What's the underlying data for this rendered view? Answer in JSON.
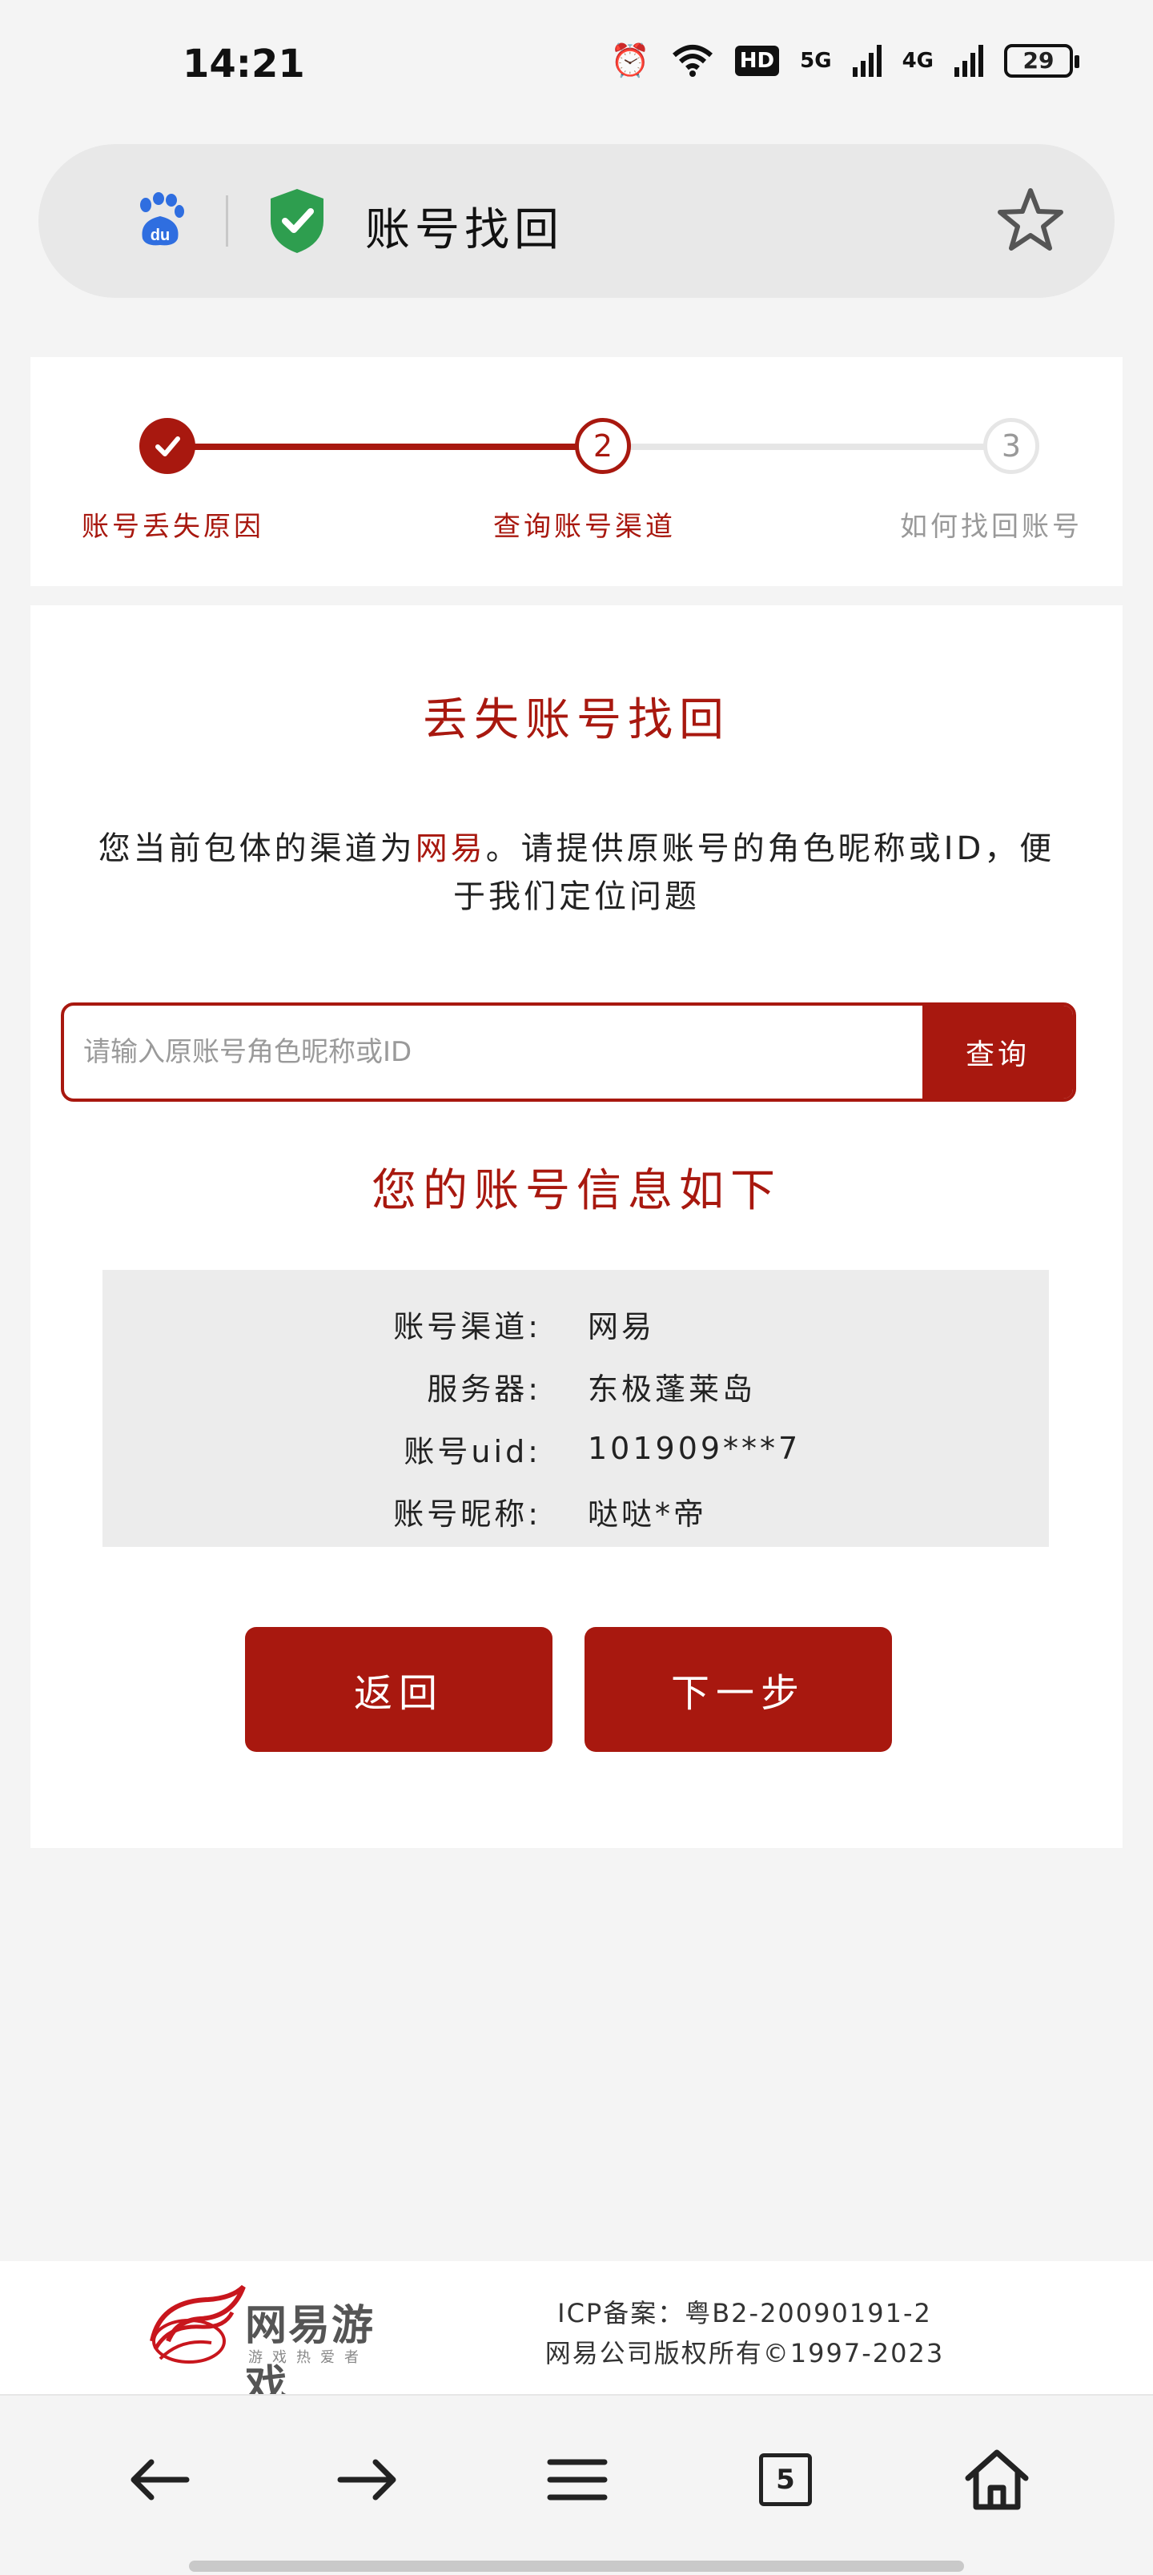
{
  "status_bar": {
    "time": "14:21",
    "hd_label": "HD",
    "network_1": "5G",
    "network_2": "4G",
    "battery": "29"
  },
  "address_bar": {
    "title": "账号找回",
    "baidu_logo_text": "du"
  },
  "stepper": {
    "steps": [
      {
        "number": "1",
        "label": "账号丢失原因",
        "state": "done"
      },
      {
        "number": "2",
        "label": "查询账号渠道",
        "state": "current"
      },
      {
        "number": "3",
        "label": "如何找回账号",
        "state": "todo"
      }
    ]
  },
  "main": {
    "title": "丢失账号找回",
    "description_prefix": "您当前包体的渠道为",
    "description_channel": "网易",
    "description_suffix": "。请提供原账号的角色昵称或ID，便于我们定位问题",
    "search": {
      "placeholder": "请输入原账号角色昵称或ID",
      "value": "",
      "button_label": "查询"
    },
    "info_title": "您的账号信息如下",
    "info_rows": [
      {
        "key": "账号渠道:",
        "value": "网易"
      },
      {
        "key": "服务器:",
        "value": "东极蓬莱岛"
      },
      {
        "key": "账号uid:",
        "value": "101909***7"
      },
      {
        "key": "账号昵称:",
        "value": "哒哒*帝"
      }
    ],
    "back_label": "返回",
    "next_label": "下一步"
  },
  "footer": {
    "logo_text": "网易游戏",
    "logo_subtitle": "游戏热爱者",
    "icp": "ICP备案：粤B2-20090191-2",
    "copyright": "网易公司版权所有©1997-2023"
  },
  "browser_nav": {
    "tab_count": "5"
  },
  "colors": {
    "accent": "#a8180f",
    "inactive": "#999999",
    "panel": "#ececec",
    "page_bg": "#f4f4f4",
    "shield_green": "#2e9e4f",
    "baidu_blue": "#2f6ee0"
  }
}
